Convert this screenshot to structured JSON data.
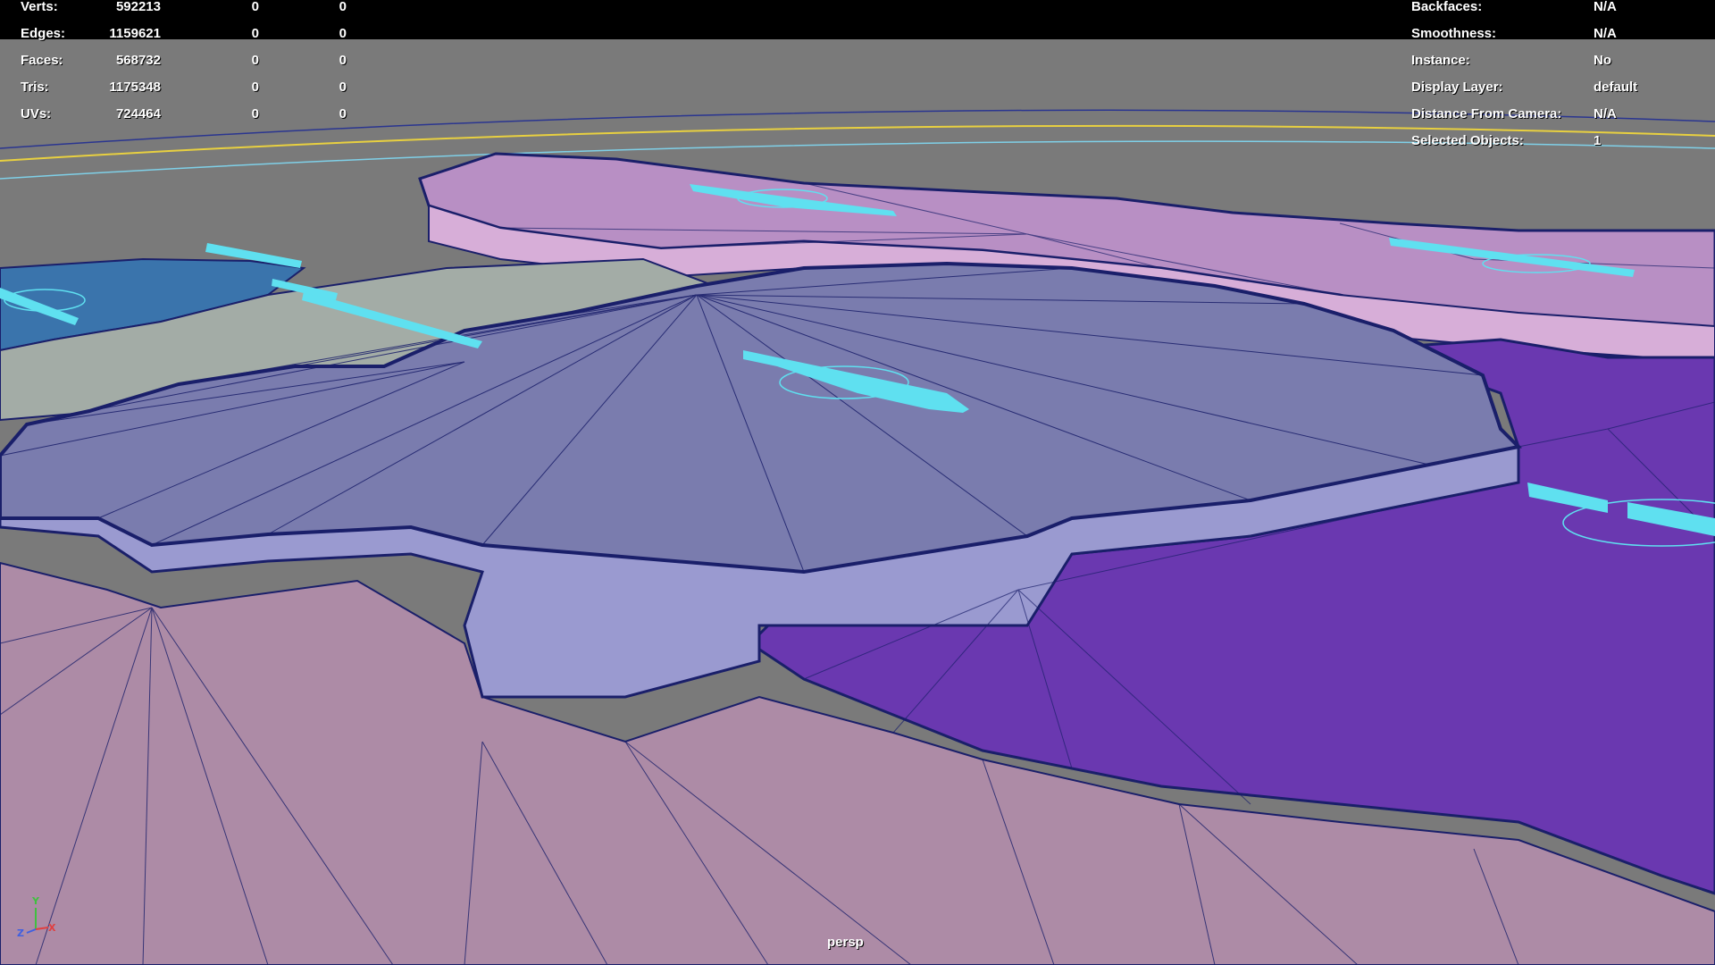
{
  "viewport": {
    "camera_name": "persp"
  },
  "hud_left": {
    "rows": [
      {
        "label": "Verts:",
        "total": "592213",
        "selected": "0",
        "other": "0"
      },
      {
        "label": "Edges:",
        "total": "1159621",
        "selected": "0",
        "other": "0"
      },
      {
        "label": "Faces:",
        "total": "568732",
        "selected": "0",
        "other": "0"
      },
      {
        "label": "Tris:",
        "total": "1175348",
        "selected": "0",
        "other": "0"
      },
      {
        "label": "UVs:",
        "total": "724464",
        "selected": "0",
        "other": "0"
      }
    ]
  },
  "hud_right": {
    "rows": [
      {
        "label": "Backfaces:",
        "value": "N/A"
      },
      {
        "label": "Smoothness:",
        "value": "N/A"
      },
      {
        "label": "Instance:",
        "value": "No"
      },
      {
        "label": "Display Layer:",
        "value": "default"
      },
      {
        "label": "Distance From Camera:",
        "value": "N/A"
      },
      {
        "label": "Selected Objects:",
        "value": "1"
      }
    ]
  },
  "axis_gizmo": {
    "labels": [
      "Z",
      "Y",
      "X"
    ],
    "colors": {
      "x": "#e04040",
      "y": "#40c040",
      "z": "#4060e0"
    }
  },
  "colors": {
    "background_grey": "#7a7a7a",
    "hud_text": "#ffffff",
    "wire_dark": "#1a1f6a",
    "cyan_label": "#5fe0f0",
    "yellow_line": "#e8d040",
    "slate_region": "#7a7cae",
    "slate_side": "#9a9ad0",
    "violet_region": "#6a38b0",
    "mauve_floor": "#ad8ba6",
    "pink_region": "#b88fc4",
    "lightpink_side": "#d7aed8",
    "green_grey_region": "#a3aca6",
    "blue_region": "#3a74ac"
  }
}
